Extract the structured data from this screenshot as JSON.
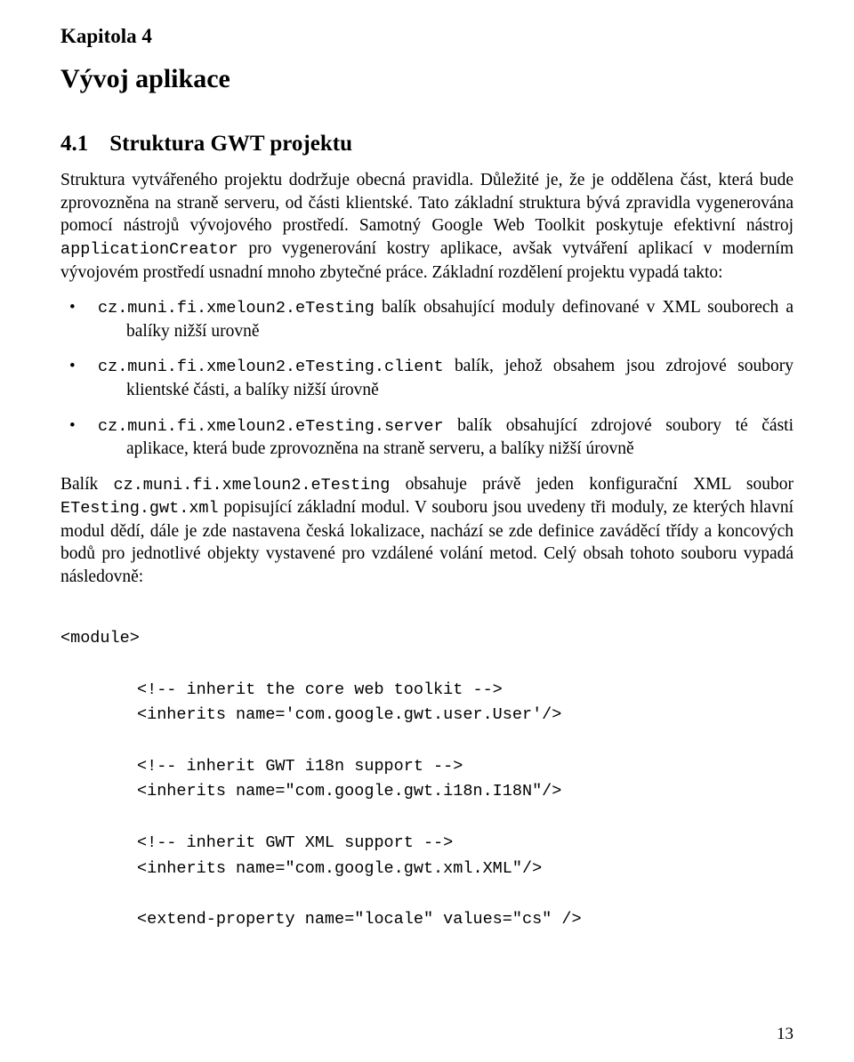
{
  "chapter": {
    "label": "Kapitola 4",
    "title": "Vývoj aplikace"
  },
  "section": {
    "number": "4.1",
    "title": "Struktura GWT projektu"
  },
  "para1": {
    "t1": "Struktura vytvářeného projektu dodržuje obecná pravidla. Důležité je, že je oddělena část, která bude zprovozněna na straně serveru, od části klientské. Tato základní struktura bývá zpravidla vygenerována pomocí nástrojů vývojového prostředí. Samotný Google Web Toolkit poskytuje efektivní nástroj ",
    "code1": "applicationCreator",
    "t2": " pro vygenerování kostry aplikace, avšak vytváření aplikací v moderním vývojovém prostředí usnadní mnoho zbytečné práce. Základní rozdělení projektu vypadá takto:"
  },
  "bullets": {
    "b1": {
      "code": "cz.muni.fi.xmeloun2.eTesting",
      "text": " balík obsahující moduly definované v XML souborech a balíky nižší urovně"
    },
    "b2": {
      "code": "cz.muni.fi.xmeloun2.eTesting.client",
      "text": " balík, jehož obsahem jsou zdrojové soubory klientské části, a balíky nižší úrovně"
    },
    "b3": {
      "code": "cz.muni.fi.xmeloun2.eTesting.server",
      "text": " balík obsahující zdrojové soubory té části aplikace, která bude zprovozněna na straně serveru, a balíky nižší úrovně"
    }
  },
  "para2": {
    "t1": "Balík ",
    "code1": "cz.muni.fi.xmeloun2.eTesting",
    "t2": " obsahuje právě jeden konfigurační XML soubor ",
    "code2": "ETesting.gwt.xml",
    "t3": " popisující základní modul. V souboru jsou uvedeny tři moduly, ze kterých hlavní modul dědí, dále je zde nastavena česká lokalizace, nachází se zde definice zaváděcí třídy a koncových bodů pro jednotlivé objekty vystavené pro vzdálené volání metod. Celý obsah tohoto souboru vypadá následovně:"
  },
  "code": {
    "l1": "<module>",
    "l2": "<!-- inherit the core web toolkit -->",
    "l3": "<inherits name='com.google.gwt.user.User'/>",
    "l4": "<!-- inherit GWT i18n support -->",
    "l5": "<inherits name=\"com.google.gwt.i18n.I18N\"/>",
    "l6": "<!-- inherit GWT XML support -->",
    "l7": "<inherits name=\"com.google.gwt.xml.XML\"/>",
    "l8": "<extend-property name=\"locale\" values=\"cs\" />"
  },
  "pageNumber": "13"
}
